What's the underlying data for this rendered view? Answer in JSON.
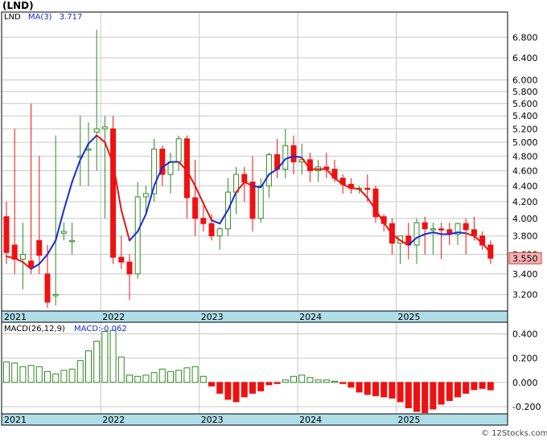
{
  "title": "(LND)",
  "watermark": "© 12Stocks.com",
  "price_legend": {
    "symbol": "LND",
    "ma_label": "MA(3)",
    "ma_value": "3.717"
  },
  "macd_legend": {
    "label": "MACD(26,12,9)",
    "value_label": "MACD:-0.062"
  },
  "last_price_label": "3.550",
  "year_labels": [
    "2021",
    "2022",
    "2023",
    "2024",
    "2025"
  ],
  "colors": {
    "up": "#2e8b22",
    "down": "#ee1111",
    "ma_up": "#1a2bd6",
    "ma_down": "#ee1111",
    "axis_band": "#b0dde8",
    "grid": "#c8c8c8"
  },
  "chart_data": [
    {
      "type": "candlestick",
      "name": "price",
      "scale": "log",
      "ylim": [
        3.05,
        7.2
      ],
      "y_ticks": [
        "6.800",
        "6.400",
        "6.000",
        "5.800",
        "5.600",
        "5.400",
        "5.200",
        "5.000",
        "4.800",
        "4.600",
        "4.400",
        "4.200",
        "4.000",
        "3.800",
        "3.600",
        "3.400",
        "3.200"
      ],
      "x": [
        "2021-01",
        "2021-02",
        "2021-03",
        "2021-04",
        "2021-05",
        "2021-06",
        "2021-07",
        "2021-08",
        "2021-09",
        "2021-10",
        "2021-11",
        "2021-12",
        "2022-01",
        "2022-02",
        "2022-03",
        "2022-04",
        "2022-05",
        "2022-06",
        "2022-07",
        "2022-08",
        "2022-09",
        "2022-10",
        "2022-11",
        "2022-12",
        "2023-01",
        "2023-02",
        "2023-03",
        "2023-04",
        "2023-05",
        "2023-06",
        "2023-07",
        "2023-08",
        "2023-09",
        "2023-10",
        "2023-11",
        "2023-12",
        "2024-01",
        "2024-02",
        "2024-03",
        "2024-04",
        "2024-05",
        "2024-06",
        "2024-07",
        "2024-08",
        "2024-09",
        "2024-10",
        "2024-11",
        "2024-12",
        "2025-01",
        "2025-02",
        "2025-03",
        "2025-04",
        "2025-05",
        "2025-06",
        "2025-07",
        "2025-08",
        "2025-09",
        "2025-10",
        "2025-11",
        "2025-12"
      ],
      "open": [
        4.02,
        3.7,
        3.55,
        3.53,
        3.75,
        3.4,
        3.2,
        3.83,
        3.75,
        4.8,
        4.9,
        5.15,
        5.2,
        5.2,
        3.57,
        3.52,
        3.4,
        4.26,
        4.3,
        4.9,
        4.55,
        4.72,
        5.05,
        4.25,
        4.0,
        3.94,
        3.8,
        3.88,
        4.32,
        4.55,
        4.45,
        4.0,
        4.4,
        4.82,
        4.62,
        4.95,
        4.72,
        4.75,
        4.6,
        4.65,
        4.62,
        4.5,
        4.42,
        4.37,
        4.37,
        4.36,
        4.02,
        3.94,
        3.72,
        3.8,
        3.7,
        3.95,
        3.88,
        3.88,
        3.87,
        3.82,
        3.94,
        3.87,
        3.8,
        3.7
      ],
      "close": [
        3.62,
        3.55,
        3.6,
        3.47,
        3.59,
        3.13,
        3.2,
        3.85,
        3.75,
        4.8,
        4.9,
        5.2,
        5.23,
        3.57,
        3.52,
        3.4,
        4.26,
        4.3,
        4.9,
        4.55,
        4.72,
        5.05,
        4.25,
        4.0,
        3.94,
        3.8,
        3.88,
        4.32,
        4.55,
        4.45,
        4.0,
        4.4,
        4.82,
        4.62,
        4.95,
        4.72,
        4.75,
        4.6,
        4.65,
        4.62,
        4.5,
        4.42,
        4.37,
        4.37,
        4.36,
        4.02,
        3.94,
        3.72,
        3.8,
        3.7,
        3.95,
        3.88,
        3.88,
        3.87,
        3.82,
        3.94,
        3.87,
        3.8,
        3.7,
        3.56
      ],
      "high": [
        4.2,
        5.2,
        3.95,
        5.6,
        4.8,
        3.7,
        5.1,
        3.95,
        3.95,
        5.4,
        5.3,
        6.95,
        5.4,
        5.4,
        3.8,
        3.6,
        4.45,
        4.4,
        5.05,
        4.95,
        4.85,
        5.1,
        5.1,
        4.75,
        4.15,
        4.05,
        3.9,
        4.5,
        4.65,
        4.65,
        4.8,
        4.5,
        4.85,
        5.05,
        5.2,
        5.1,
        4.98,
        4.85,
        4.75,
        4.85,
        4.75,
        4.55,
        4.5,
        4.4,
        4.55,
        4.4,
        4.05,
        4.0,
        3.8,
        3.95,
        4.0,
        4.02,
        3.95,
        3.95,
        3.95,
        3.95,
        4.0,
        4.02,
        3.85,
        3.75
      ],
      "low": [
        3.5,
        3.4,
        3.25,
        3.4,
        3.4,
        3.08,
        3.1,
        3.75,
        3.6,
        4.4,
        4.4,
        4.6,
        4.0,
        3.5,
        3.45,
        3.15,
        3.35,
        4.05,
        4.2,
        4.4,
        4.3,
        4.6,
        4.0,
        3.8,
        3.85,
        3.75,
        3.65,
        3.8,
        4.05,
        4.2,
        3.85,
        3.95,
        4.25,
        4.5,
        4.5,
        4.55,
        4.55,
        4.45,
        4.45,
        4.5,
        4.45,
        4.3,
        4.3,
        4.3,
        4.2,
        3.95,
        3.85,
        3.6,
        3.5,
        3.55,
        3.5,
        3.6,
        3.6,
        3.55,
        3.7,
        3.7,
        3.6,
        3.75,
        3.65,
        3.5
      ],
      "ma3": [
        3.58,
        3.56,
        3.52,
        3.45,
        3.5,
        3.6,
        3.75,
        4.1,
        4.45,
        4.75,
        4.98,
        5.1,
        5.0,
        4.7,
        4.1,
        3.75,
        3.85,
        4.05,
        4.4,
        4.65,
        4.72,
        4.72,
        4.6,
        4.4,
        4.18,
        3.98,
        3.94,
        4.1,
        4.32,
        4.45,
        4.4,
        4.38,
        4.55,
        4.62,
        4.76,
        4.8,
        4.78,
        4.62,
        4.62,
        4.62,
        4.5,
        4.42,
        4.37,
        4.36,
        4.25,
        4.1,
        3.95,
        3.82,
        3.75,
        3.7,
        3.78,
        3.82,
        3.84,
        3.82,
        3.82,
        3.84,
        3.83,
        3.8,
        3.72,
        3.62
      ],
      "ma3_direction": [
        "down",
        "down",
        "down",
        "down",
        "up",
        "up",
        "up",
        "up",
        "up",
        "up",
        "up",
        "up",
        "down",
        "down",
        "down",
        "down",
        "up",
        "up",
        "up",
        "up",
        "up",
        "up",
        "down",
        "down",
        "down",
        "down",
        "up",
        "up",
        "up",
        "down",
        "down",
        "up",
        "up",
        "up",
        "up",
        "up",
        "up",
        "down",
        "down",
        "down",
        "down",
        "down",
        "down",
        "down",
        "down",
        "down",
        "down",
        "down",
        "down",
        "down",
        "up",
        "up",
        "up",
        "up",
        "up",
        "up",
        "up",
        "down",
        "down",
        "down"
      ]
    },
    {
      "type": "bar",
      "name": "MACD histogram",
      "ylim": [
        -0.26,
        0.47
      ],
      "y_ticks": [
        "0.400",
        "0.200",
        "0.000",
        "-0.200"
      ],
      "values": [
        0.17,
        0.16,
        0.13,
        0.14,
        0.13,
        0.09,
        0.07,
        0.1,
        0.11,
        0.18,
        0.26,
        0.34,
        0.42,
        0.43,
        0.21,
        0.06,
        0.05,
        0.06,
        0.08,
        0.11,
        0.09,
        0.1,
        0.12,
        0.13,
        0.05,
        -0.03,
        -0.09,
        -0.14,
        -0.16,
        -0.12,
        -0.09,
        -0.07,
        -0.02,
        -0.01,
        0.02,
        0.05,
        0.06,
        0.04,
        0.02,
        0.02,
        0.01,
        -0.01,
        -0.04,
        -0.08,
        -0.1,
        -0.11,
        -0.12,
        -0.13,
        -0.16,
        -0.21,
        -0.24,
        -0.25,
        -0.22,
        -0.18,
        -0.15,
        -0.12,
        -0.09,
        -0.06,
        -0.05,
        -0.062
      ]
    }
  ]
}
